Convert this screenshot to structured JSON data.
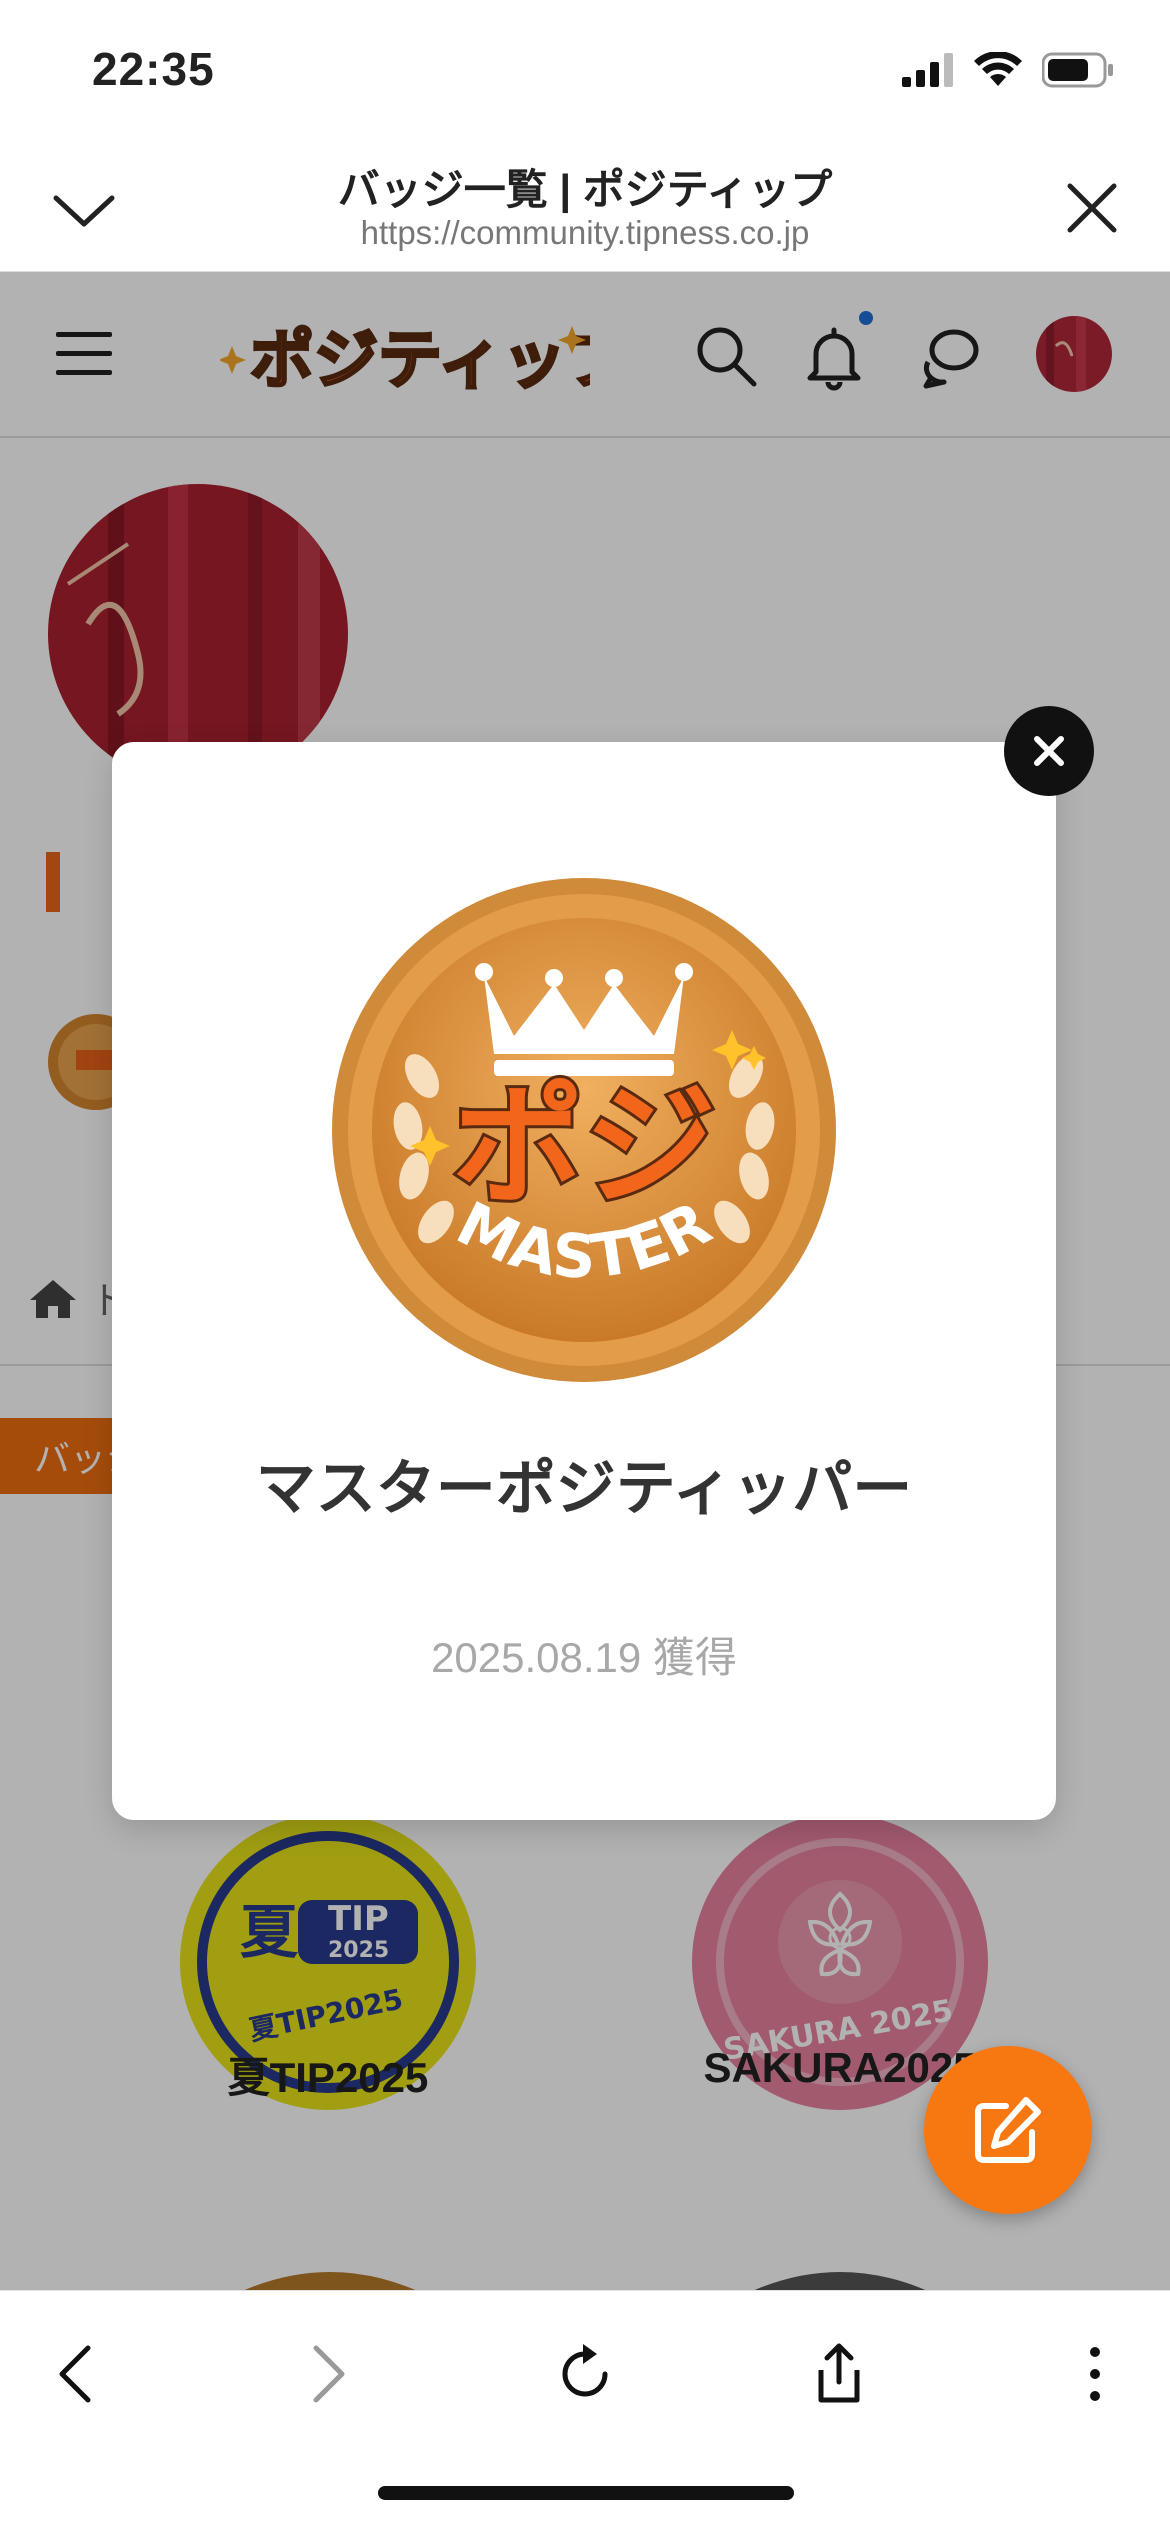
{
  "status_bar": {
    "time": "22:35"
  },
  "browser": {
    "title": "バッジ一覧 | ポジティップ",
    "url": "https://community.tipness.co.jp"
  },
  "site_header": {
    "logo_text": "ポジティップ"
  },
  "page": {
    "crumb_home_text": "ト",
    "tab_label": "バッジ",
    "badges": [
      {
        "name": "夏TIP2025",
        "art_text_1": "夏",
        "art_text_2": "TIP",
        "art_text_3": "2025",
        "art_text_4": "夏TIP2025"
      },
      {
        "name": "SAKURA2025",
        "art_text": "SAKURA 2025"
      }
    ]
  },
  "modal": {
    "badge_art_text_main": "ポジ",
    "badge_art_text_sub": "MASTER",
    "badge_name": "マスターポジティッパー",
    "date": "2025.08.19 獲得"
  },
  "colors": {
    "accent_orange": "#f77711",
    "badge_gold": "#e0913a",
    "notification_dot": "#1e6fd6"
  }
}
